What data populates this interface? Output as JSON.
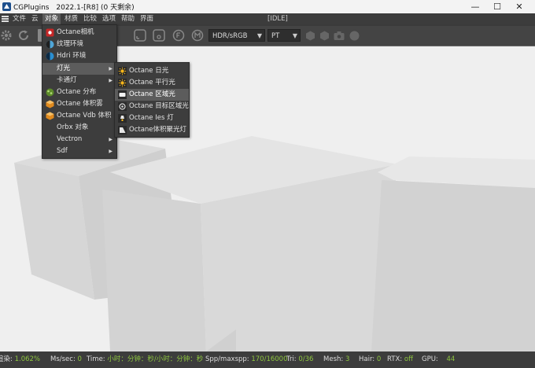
{
  "window": {
    "app_name": "CGPlugins",
    "version_text": "2022.1-[R8] (0 天剩余)",
    "minimize_glyph": "—",
    "maximize_glyph": "☐",
    "close_glyph": "✕"
  },
  "menubar": {
    "items": [
      "文件",
      "云",
      "对象",
      "材质",
      "比较",
      "选项",
      "帮助",
      "界面"
    ],
    "active_index": 2,
    "status": "[IDLE]"
  },
  "toolbar": {
    "color_space": "HDR/sRGB",
    "kernel": "PT"
  },
  "object_menu": {
    "items": [
      {
        "label": "Octane相机",
        "icon": "camera-icon"
      },
      {
        "label": "纹理环境",
        "icon": "texture-environment-icon"
      },
      {
        "label": "Hdri 环境",
        "icon": "hdri-environment-icon"
      },
      {
        "label": "灯光",
        "icon": "",
        "submenu": true
      },
      {
        "label": "卡通灯",
        "icon": "",
        "submenu": true
      },
      {
        "label": "Octane 分布",
        "icon": "scatter-icon"
      },
      {
        "label": "Octane 体积雾",
        "icon": "fog-volume-icon"
      },
      {
        "label": "Octane Vdb 体积",
        "icon": "vdb-volume-icon"
      },
      {
        "label": "Orbx 对象",
        "icon": ""
      },
      {
        "label": "Vectron",
        "icon": "",
        "submenu": true
      },
      {
        "label": "Sdf",
        "icon": "",
        "submenu": true
      }
    ],
    "highlight_index": 3
  },
  "light_submenu": {
    "items": [
      {
        "label": "Octane 日光",
        "icon": "daylight-icon"
      },
      {
        "label": "Octane 平行光",
        "icon": "directional-light-icon"
      },
      {
        "label": "Octane 区域光",
        "icon": "area-light-icon"
      },
      {
        "label": "Octane 目标区域光",
        "icon": "targeted-area-light-icon"
      },
      {
        "label": "Octane Ies 灯",
        "icon": "ies-light-icon"
      },
      {
        "label": "Octane体积聚光灯",
        "icon": "volumetric-spotlight-icon"
      }
    ],
    "highlight_index": 2
  },
  "statusbar": {
    "render_label": "渲染:",
    "render_value": "1.062%",
    "ms_label": "Ms/sec:",
    "ms_value": "0",
    "time_label": "Time:",
    "time_value": "小时：分钟：秒/小时：分钟：秒",
    "spp_label": "Spp/maxspp:",
    "spp_value": "170/16000",
    "tri_label": "Tri:",
    "tri_value": "0/36",
    "mesh_label": "Mesh:",
    "mesh_value": "3",
    "hair_label": "Hair:",
    "hair_value": "0",
    "rtx_label": "RTX:",
    "rtx_value": "off",
    "gpu_label": "GPU:",
    "gpu_value": "44"
  },
  "colors": {
    "accent_green": "#8ec63f",
    "menu_bg": "#3d3d3d",
    "highlight": "#5c5c5c"
  }
}
